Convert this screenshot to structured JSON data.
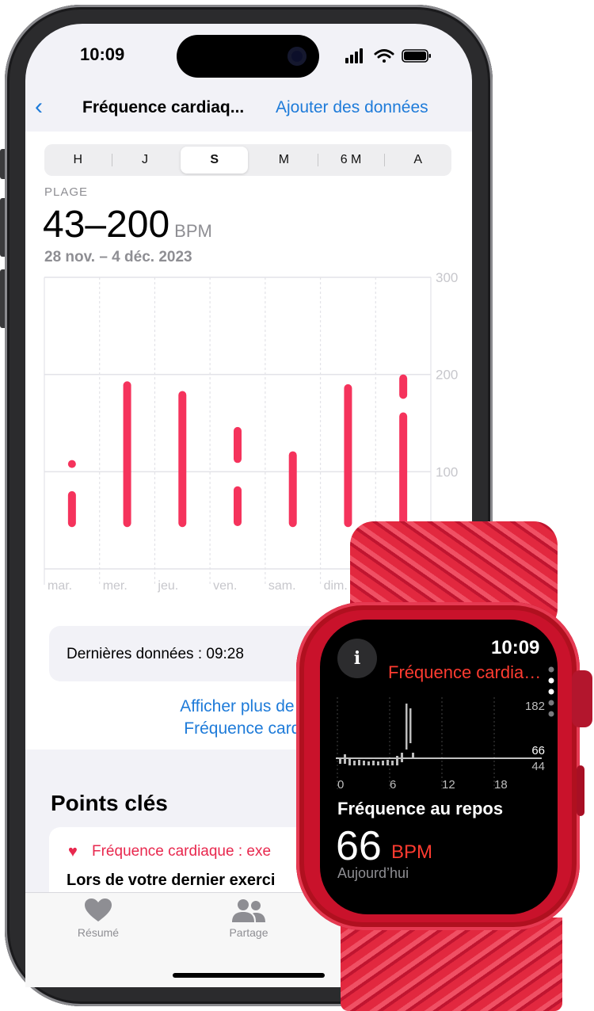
{
  "status_bar": {
    "time": "10:09"
  },
  "nav": {
    "title": "Fréquence cardiaq...",
    "action": "Ajouter des données"
  },
  "segments": [
    "H",
    "J",
    "S",
    "M",
    "6 M",
    "A"
  ],
  "selected_segment": "S",
  "summary": {
    "label": "PLAGE",
    "range": "43–200",
    "unit": "BPM",
    "dates": "28 nov. – 4 déc. 2023"
  },
  "chart_data": {
    "type": "range-bar",
    "categories": [
      "mar.",
      "mer.",
      "jeu.",
      "ven.",
      "sam.",
      "dim."
    ],
    "y_ticks": [
      100,
      200,
      300
    ],
    "ylim": [
      0,
      300
    ],
    "grid": true,
    "colors": {
      "bar": "#f5335c"
    },
    "segments": [
      [
        [
          43,
          80
        ],
        [
          106,
          112
        ]
      ],
      [
        [
          43,
          193
        ]
      ],
      [
        [
          43,
          183
        ]
      ],
      [
        [
          44,
          85
        ],
        [
          109,
          146
        ]
      ],
      [
        [
          43,
          121
        ]
      ],
      [
        [
          43,
          190
        ]
      ],
      [
        [
          43,
          161
        ],
        [
          175,
          200
        ]
      ]
    ]
  },
  "last_data": {
    "text": "Dernières données : 09:28"
  },
  "more_link": {
    "line1": "Afficher plus de do",
    "line2": "Fréquence cardia"
  },
  "key_points": {
    "title": "Points clés",
    "card_title": "Fréquence cardiaque : exe",
    "card_body": "Lors de votre dernier exerci"
  },
  "tabbar": [
    {
      "label": "Résumé",
      "icon": "heart-icon"
    },
    {
      "label": "Partage",
      "icon": "people-icon"
    }
  ],
  "watch": {
    "time": "10:09",
    "info_glyph": "i",
    "title": "Fréquence cardiaque",
    "label": "Fréquence au repos",
    "value": "66",
    "unit": "BPM",
    "subtitle": "Aujourd’hui",
    "chart": {
      "x_ticks": [
        "0",
        "6",
        "12",
        "18"
      ],
      "y_ticks": [
        "182",
        "66",
        "44"
      ]
    }
  },
  "colors": {
    "accent": "#1e7bd9",
    "heart_red": "#f5335c",
    "watch_red": "#ff3b30"
  }
}
